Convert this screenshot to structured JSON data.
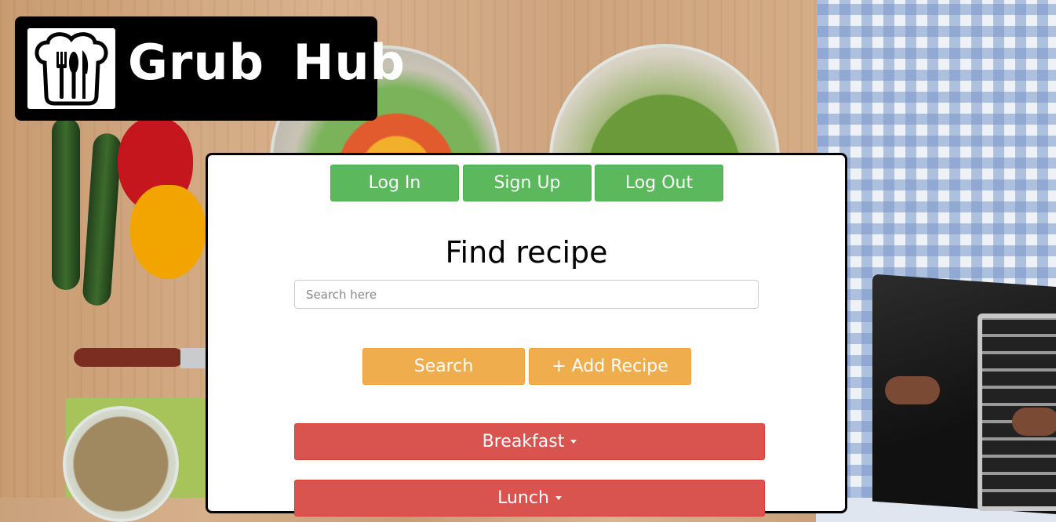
{
  "logo": {
    "text": "Grub Hub",
    "icon": "chef-hat-utensils-icon"
  },
  "auth": {
    "login_label": "Log In",
    "signup_label": "Sign Up",
    "logout_label": "Log Out"
  },
  "main": {
    "title": "Find recipe",
    "search_placeholder": "Search here",
    "search_label": "Search",
    "add_recipe_label": "+ Add Recipe"
  },
  "categories": [
    {
      "label": "Breakfast",
      "has_dropdown": true
    },
    {
      "label": "Lunch",
      "has_dropdown": true
    }
  ],
  "colors": {
    "green": "#5cb85c",
    "orange": "#f0ad4e",
    "red": "#d9534f"
  }
}
